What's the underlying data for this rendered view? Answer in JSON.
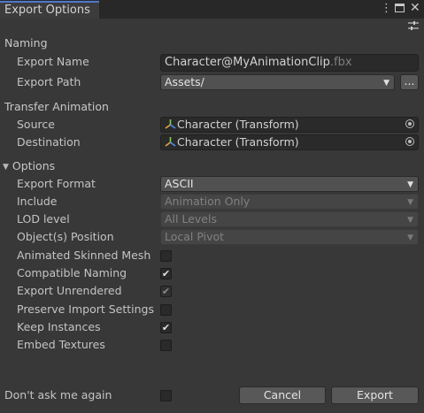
{
  "window": {
    "tab_title": "Export Options",
    "menu_icon": "kebab-menu-icon",
    "maximize_icon": "maximize-icon",
    "close_icon": "close-icon",
    "settings_icon": "preset-sliders-icon"
  },
  "naming": {
    "section_label": "Naming",
    "export_name_label": "Export Name",
    "export_name_value": "Character@MyAnimationClip",
    "export_name_ext": ".fbx",
    "export_path_label": "Export Path",
    "export_path_value": "Assets/",
    "browse_label": "..."
  },
  "transfer": {
    "section_label": "Transfer Animation",
    "source_label": "Source",
    "source_value": "Character (Transform)",
    "destination_label": "Destination",
    "destination_value": "Character (Transform)"
  },
  "options": {
    "section_label": "Options",
    "foldout_icon": "triangle-down-icon",
    "export_format_label": "Export Format",
    "export_format_value": "ASCII",
    "include_label": "Include",
    "include_value": "Animation Only",
    "lod_label": "LOD level",
    "lod_value": "All Levels",
    "position_label": "Object(s) Position",
    "position_value": "Local Pivot",
    "checkboxes": [
      {
        "label": "Animated Skinned Mesh",
        "checked": false,
        "enabled": true
      },
      {
        "label": "Compatible Naming",
        "checked": true,
        "enabled": true
      },
      {
        "label": "Export Unrendered",
        "checked": true,
        "enabled": false
      },
      {
        "label": "Preserve Import Settings",
        "checked": false,
        "enabled": true
      },
      {
        "label": "Keep Instances",
        "checked": true,
        "enabled": true
      },
      {
        "label": "Embed Textures",
        "checked": false,
        "enabled": true
      }
    ]
  },
  "footer": {
    "dont_ask_label": "Don't ask me again",
    "dont_ask_checked": false,
    "cancel_label": "Cancel",
    "export_label": "Export"
  },
  "colors": {
    "background": "#383838",
    "titlebar": "#282828",
    "tab_accent": "#4d78cc"
  }
}
